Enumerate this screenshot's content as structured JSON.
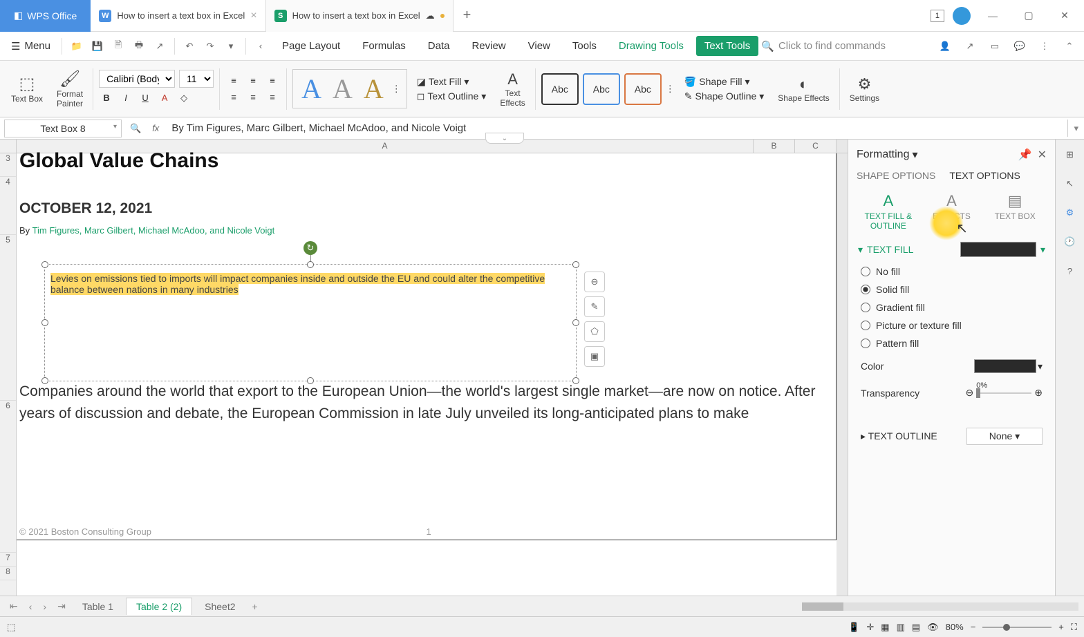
{
  "app": {
    "name": "WPS Office"
  },
  "tabs": [
    {
      "label": "How to insert a text box in Excel",
      "type": "w"
    },
    {
      "label": "How to insert a text box in Excel",
      "type": "s",
      "active": true,
      "dirty": true
    }
  ],
  "menu": {
    "label": "Menu",
    "items": [
      "Page Layout",
      "Formulas",
      "Data",
      "Review",
      "View",
      "Tools",
      "Drawing Tools",
      "Text Tools"
    ],
    "search_placeholder": "Click to find commands"
  },
  "ribbon": {
    "textbox": "Text Box",
    "format_painter": "Format\nPainter",
    "font": "Calibri (Body)",
    "font_size": "11",
    "text_fill": "Text Fill",
    "text_outline": "Text Outline",
    "text_effects": "Text\nEffects",
    "shape_styles": [
      "Abc",
      "Abc",
      "Abc"
    ],
    "shape_fill": "Shape Fill",
    "shape_outline": "Shape Outline",
    "shape_effects": "Shape Effects",
    "settings": "Settings"
  },
  "namebox": "Text Box 8",
  "formula": "By Tim Figures, Marc Gilbert, Michael McAdoo, and Nicole Voigt",
  "columns": [
    "A",
    "B",
    "C"
  ],
  "rows": [
    "3",
    "4",
    "5",
    "6",
    "7",
    "8"
  ],
  "doc": {
    "title": "Global Value Chains",
    "date": "OCTOBER 12, 2021",
    "byline_prefix": "By ",
    "byline_authors": "Tim Figures, Marc Gilbert, Michael McAdoo, and Nicole Voigt",
    "textbox": "Levies on emissions tied to imports will impact companies inside and outside the EU and could alter the competitive balance between nations in many industries",
    "body": "Companies around the world that export to the European Union—the world's largest single market—are now on notice. After years of discussion and debate, the European Commission in late July unveiled its long-anticipated plans to make",
    "footer": "© 2021 Boston Consulting Group",
    "page": "1"
  },
  "panel": {
    "title": "Formatting",
    "shape_options": "SHAPE OPTIONS",
    "text_options": "TEXT OPTIONS",
    "subtabs": {
      "fill": "TEXT FILL & OUTLINE",
      "effects": "EFFECTS",
      "textbox": "TEXT BOX"
    },
    "text_fill": "TEXT FILL",
    "fills": {
      "no": "No fill",
      "solid": "Solid fill",
      "gradient": "Gradient fill",
      "picture": "Picture or texture fill",
      "pattern": "Pattern fill"
    },
    "color_label": "Color",
    "transparency_label": "Transparency",
    "transparency_value": "0%",
    "text_outline": "TEXT OUTLINE",
    "outline_value": "None"
  },
  "sheets": {
    "tabs": [
      "Table 1",
      "Table 2 (2)",
      "Sheet2"
    ],
    "active": 1
  },
  "status": {
    "zoom": "80%"
  }
}
